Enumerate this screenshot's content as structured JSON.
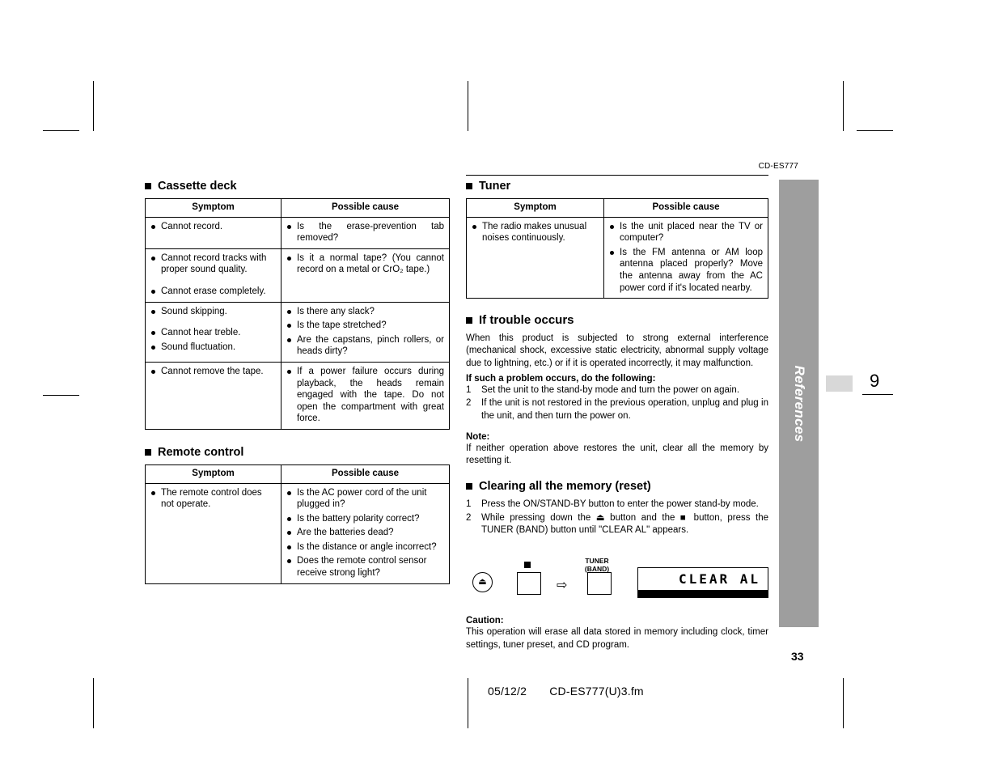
{
  "document": {
    "model_code": "CD-ES777",
    "page_number_big": "9",
    "page_number_bottom": "33",
    "side_tab_label": "References",
    "footer_date": "05/12/2",
    "footer_file": "CD-ES777(U)3.fm"
  },
  "sections": {
    "cassette_deck": {
      "title": "Cassette deck",
      "headers": [
        "Symptom",
        "Possible cause"
      ],
      "rows": [
        {
          "symptoms": [
            "Cannot record."
          ],
          "causes": [
            "Is the erase-prevention tab removed?"
          ]
        },
        {
          "symptoms": [
            "Cannot record tracks with proper sound quality.",
            "Cannot erase completely."
          ],
          "causes": [
            "Is it a normal tape? (You cannot record on a metal or CrO₂ tape.)"
          ]
        },
        {
          "symptoms": [
            "Sound skipping.",
            "Cannot hear treble.",
            "Sound fluctuation."
          ],
          "causes": [
            "Is there any slack?",
            "Is the tape stretched?",
            "Are the capstans, pinch rollers, or heads dirty?"
          ]
        },
        {
          "symptoms": [
            "Cannot remove the tape."
          ],
          "causes": [
            "If a power failure occurs during playback, the heads remain engaged with the tape. Do not open the compartment with great force."
          ]
        }
      ]
    },
    "remote_control": {
      "title": "Remote control",
      "headers": [
        "Symptom",
        "Possible cause"
      ],
      "rows": [
        {
          "symptoms": [
            "The remote control does not operate."
          ],
          "causes": [
            "Is the AC power cord of the unit plugged in?",
            "Is the battery polarity correct?",
            "Are the batteries dead?",
            "Is the distance or angle incorrect?",
            "Does the remote control sensor receive strong light?"
          ]
        }
      ]
    },
    "tuner": {
      "title": "Tuner",
      "headers": [
        "Symptom",
        "Possible cause"
      ],
      "rows": [
        {
          "symptoms": [
            "The radio makes unusual noises continuously."
          ],
          "causes": [
            "Is the unit placed near the TV or computer?",
            "Is the FM antenna or AM loop antenna placed properly? Move the antenna away from the AC power cord if it's located nearby."
          ]
        }
      ]
    },
    "if_trouble_occurs": {
      "title": "If trouble occurs",
      "intro": "When this product is subjected to strong external interference (mechanical shock, excessive static electricity, abnormal supply voltage due to lightning, etc.) or if it is operated incorrectly, it may malfunction.",
      "subhead": "If such a problem occurs, do the following:",
      "steps": [
        {
          "n": "1",
          "text": "Set the unit to the stand-by mode and turn the power on again."
        },
        {
          "n": "2",
          "text": "If the unit is not restored in the previous operation, unplug and plug in the unit, and then turn the power on."
        }
      ],
      "note_label": "Note:",
      "note_text": "If neither operation above restores the unit, clear all the memory by resetting it."
    },
    "clearing_memory": {
      "title": "Clearing all the memory (reset)",
      "steps": [
        {
          "n": "1",
          "text": "Press the ON/STAND-BY button to enter the power stand-by mode."
        },
        {
          "n": "2",
          "text": "While pressing down the ⏏ button and the ■ button, press the TUNER (BAND) button until \"CLEAR AL\" appears."
        }
      ],
      "diagram": {
        "eject_icon": "⏏",
        "stop_icon": "■",
        "arrow_icon": "⇨",
        "tuner_label_line1": "TUNER",
        "tuner_label_line2": "(BAND)",
        "display_text": "CLEAR AL"
      },
      "caution_label": "Caution:",
      "caution_text": "This operation will erase all data stored in memory including clock, timer settings, tuner preset, and CD program."
    }
  }
}
